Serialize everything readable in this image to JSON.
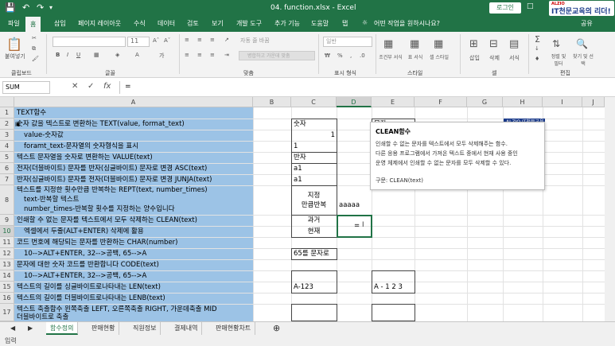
{
  "title": "04. function.xlsx  -  Excel",
  "login": "로그인",
  "logo": {
    "small": "ALZIO",
    "main": "IT천문교육의 리더!"
  },
  "tabs": [
    "파일",
    "홈",
    "삽입",
    "페이지 레이아웃",
    "수식",
    "데이터",
    "검토",
    "보기",
    "개발 도구",
    "추가 기능",
    "도움말",
    "탭"
  ],
  "tellme": "어떤 작업을 원하시나요?",
  "share": "공유",
  "ribbon": {
    "paste": "붙여넣기",
    "font_size": "11",
    "wrap": "자동 줄 바꿈",
    "merge": "병합하고 가운데 맞춤",
    "number_format": "일반",
    "cond_format": "조건부 서식",
    "table_format": "표 서식",
    "cell_style": "셀 스타일",
    "insert": "삽입",
    "delete": "삭제",
    "format": "서식",
    "sort": "정렬 및 필터",
    "find": "찾기 및 선택",
    "groups": [
      "클립보드",
      "글꼴",
      "맞춤",
      "표시 형식",
      "스타일",
      "셀",
      "편집"
    ]
  },
  "namebox": "SUM",
  "formula": "=",
  "columns": [
    "A",
    "B",
    "C",
    "D",
    "E",
    "F",
    "G",
    "H",
    "I",
    "J"
  ],
  "rows": [
    "1",
    "2",
    "3",
    "4",
    "5",
    "6",
    "7",
    "8",
    "9",
    "10",
    "11",
    "12",
    "13",
    "14",
    "15",
    "16",
    "17"
  ],
  "cells": {
    "a1": "TEXT함수",
    "a2": "숫자 값을 텍스트로 변환하는 TEXT(value, format_text)",
    "a3": "value-숫자값",
    "a4": "foramt_text-문자열의 숫자형식을 표시",
    "a5": "텍스트 문자열을 숫자로 변환하는 VALUE(text)",
    "a6": "전자(더블바이트) 문자를 반자(싱글바이트) 문자로 변경 ASC(text)",
    "a7": "반자(싱글바이트) 문자를 전자(더블바이트) 문자로 변경 JUNJA(text)",
    "a8a": "텍스트를 지정한 횟수만큼 반복하는 REPT(text, number_times)",
    "a8b": "text-반복할 텍스트",
    "a8c": "number_times-반복할 횟수를 지정하는 양수입니다",
    "a9": "인쇄할 수 없는 문자를 텍스트에서 모두 삭제하는 CLEAN(text)",
    "a10": "엑셀에서 두줄(ALT+ENTER) 삭제에 활용",
    "a11": "코드 번호에 해당되는 문자를 반환하는 CHAR(number)",
    "a12": "10-->ALT+ENTER, 32-->공백, 65-->A",
    "a13": "문자에 대한 숫자 코드를 반환합니다 CODE(text)",
    "a14": "10-->ALT+ENTER, 32-->공백, 65-->A",
    "a15": "텍스트의 길이를 싱글바이트로나타내는 LEN(text)",
    "a16": "텍스트의 길이를 더블바이트로나타내는 LENB(text)",
    "a17": "텍스트 축출함수 왼쪽축출 LEFT, 오른쪽축출 RIGHT, 가운데축출 MID",
    "a18": "더블바이트로 축출",
    "c2": "숫자",
    "e2": "문자",
    "c3": "1",
    "e3": "1",
    "c4": "1",
    "e4": "1",
    "c5": "반자",
    "e5": "전자",
    "c6": "a1",
    "e6": "a 1",
    "c7": "a1",
    "c8a": "지정",
    "c8b": "만큼반복",
    "d8": "aaaaa",
    "c9": "과거",
    "c10": "현재",
    "d9": "=",
    "c13": "65를 문자로",
    "c15": "A-123",
    "e15": "A - 1 2 3"
  },
  "tooltip": {
    "badge": "ALZIO  IT천문교육",
    "title": "CLEAN함수",
    "lines": [
      "인쇄할 수 없는 문자를 텍스트에서 모두 삭제해주는 함수.",
      "다른 응용 프로그램에서 가져온 텍스트 중에서 현재 사용 중인",
      "운영 체제에서 인쇄할 수 없는 문자를 모두 삭제할 수 있다."
    ],
    "syntax": "구문: CLEAN(text)"
  },
  "sheets": [
    "함수정의",
    "판매현황",
    "직원정보",
    "결제내역",
    "판매현황차트"
  ],
  "status": "입력",
  "colors": {
    "excel_green": "#217346",
    "cell_blue": "#9cc3e6"
  }
}
